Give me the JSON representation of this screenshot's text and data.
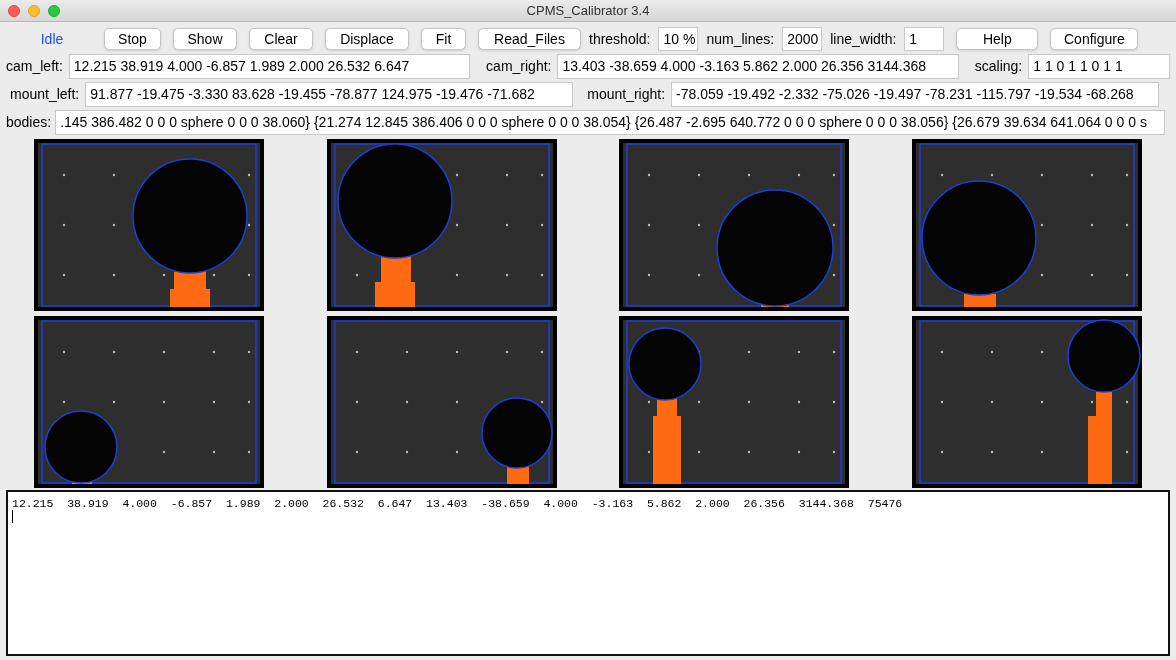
{
  "window": {
    "title": "CPMS_Calibrator 3.4"
  },
  "status": "Idle",
  "buttons_left": [
    "Stop",
    "Show",
    "Clear",
    "Displace",
    "Fit",
    "Read_Files"
  ],
  "settings": [
    {
      "label": "threshold:",
      "value": "10 %"
    },
    {
      "label": "num_lines:",
      "value": "2000"
    },
    {
      "label": "line_width:",
      "value": "1"
    }
  ],
  "buttons_right": [
    "Help",
    "Configure"
  ],
  "cam_left": {
    "label": "cam_left:",
    "value": "12.215 38.919 4.000 -6.857 1.989 2.000 26.532 6.647"
  },
  "cam_right": {
    "label": "cam_right:",
    "value": "13.403 -38.659 4.000 -3.163 5.862 2.000 26.356 3144.368"
  },
  "scaling": {
    "label": "scaling:",
    "value": "1 1 0 1 1 0 1 1"
  },
  "mount_left": {
    "label": "mount_left:",
    "value": "91.877 -19.475 -3.330 83.628 -19.455 -78.877 124.975 -19.476 -71.682"
  },
  "mount_right": {
    "label": "mount_right:",
    "value": "-78.059 -19.492 -2.332 -75.026 -19.497 -78.231 -115.797 -19.534 -68.268"
  },
  "bodies": {
    "label": "bodies:",
    "value": ".145 386.482 0 0 0 sphere 0 0 0 38.060} {21.274 12.845 386.406 0 0 0 sphere 0 0 0 38.054} {26.487 -2.695 640.772 0 0 0 sphere 0 0 0 38.056} {26.679 39.634 641.064 0 0 0 s"
  },
  "output_lines": [
    "12.215  38.919  4.000  -6.857  1.989  2.000  26.532  6.647  13.403  -38.659  4.000  -3.163  5.862  2.000  26.356  3144.368  75476"
  ]
}
